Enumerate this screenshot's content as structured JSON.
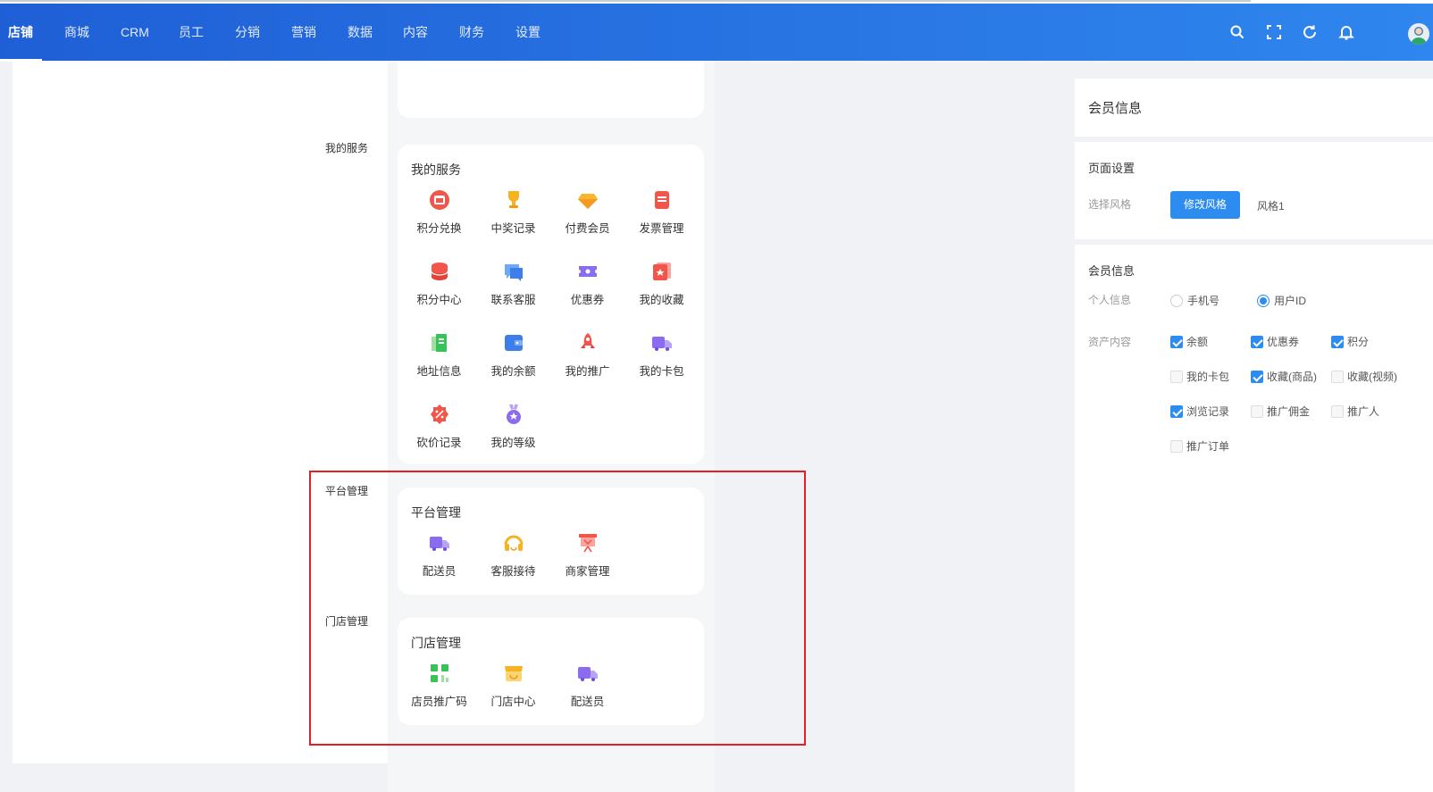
{
  "nav": {
    "items": [
      "店铺",
      "商城",
      "CRM",
      "员工",
      "分销",
      "营销",
      "数据",
      "内容",
      "财务",
      "设置"
    ],
    "active_index": 0
  },
  "header_icons": [
    "search-icon",
    "fullscreen-icon",
    "refresh-icon",
    "bell-icon",
    "avatar"
  ],
  "side_tags": {
    "my_services": "我的服务",
    "platform": "平台管理",
    "store": "门店管理"
  },
  "my_services": {
    "title": "我的服务",
    "items": [
      "积分兑换",
      "中奖记录",
      "付费会员",
      "发票管理",
      "积分中心",
      "联系客服",
      "优惠券",
      "我的收藏",
      "地址信息",
      "我的余额",
      "我的推广",
      "我的卡包",
      "砍价记录",
      "我的等级"
    ]
  },
  "platform": {
    "title": "平台管理",
    "items": [
      "配送员",
      "客服接待",
      "商家管理"
    ]
  },
  "store": {
    "title": "门店管理",
    "items": [
      "店员推广码",
      "门店中心",
      "配送员"
    ]
  },
  "right_panel": {
    "header": "会员信息",
    "page_settings": {
      "title": "页面设置",
      "style_label": "选择风格",
      "modify_button": "修改风格",
      "style_value": "风格1"
    },
    "member_info": {
      "title": "会员信息",
      "personal_label": "个人信息",
      "personal_options": [
        {
          "label": "手机号",
          "checked": false
        },
        {
          "label": "用户ID",
          "checked": true
        }
      ],
      "asset_label": "资产内容",
      "asset_options": [
        {
          "label": "余额",
          "checked": true
        },
        {
          "label": "优惠券",
          "checked": true
        },
        {
          "label": "积分",
          "checked": true
        },
        {
          "label": "我的卡包",
          "checked": false
        },
        {
          "label": "收藏(商品)",
          "checked": true
        },
        {
          "label": "收藏(视频)",
          "checked": false
        },
        {
          "label": "浏览记录",
          "checked": true
        },
        {
          "label": "推广佣金",
          "checked": false
        },
        {
          "label": "推广人",
          "checked": false
        },
        {
          "label": "推广订单",
          "checked": false
        }
      ]
    }
  },
  "colors": {
    "nav_gradient_start": "#1f5fd6",
    "nav_gradient_end": "#2f86ee",
    "primary": "#2d8cf0",
    "highlight_border": "#e31e24"
  }
}
